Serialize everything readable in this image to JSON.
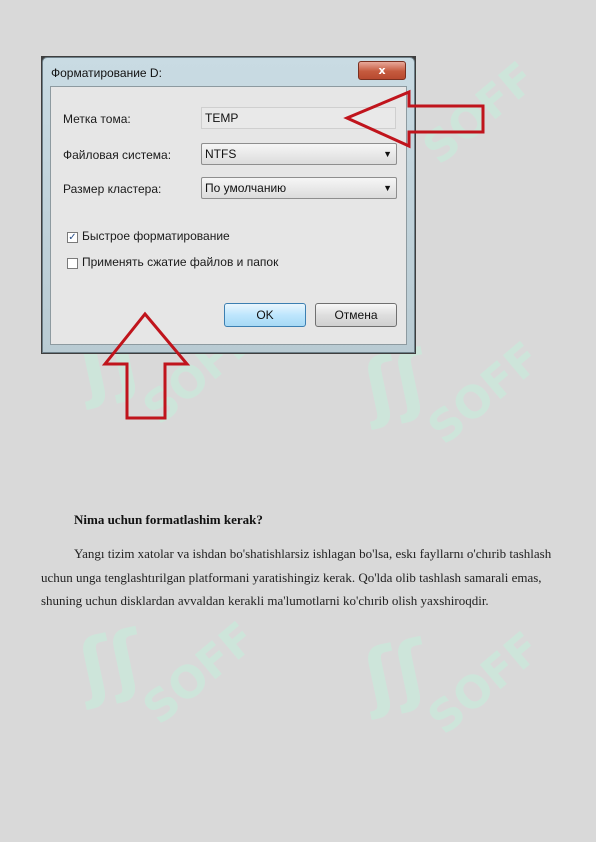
{
  "dialog": {
    "title": "Форматирование D:",
    "close_label": "x",
    "volume_label_caption": "Метка тома:",
    "volume_label_value": "TEMP",
    "filesystem_caption": "Файловая система:",
    "filesystem_value": "NTFS",
    "cluster_size_caption": "Размер кластера:",
    "cluster_size_value": "По умолчанию",
    "quick_format_label": "Быстрое форматирование",
    "quick_format_checked": true,
    "compression_label": "Применять сжатие файлов и папок",
    "compression_checked": false,
    "ok_label": "OK",
    "cancel_label": "Отмена"
  },
  "annotations": {
    "arrow_color": "#c0141c"
  },
  "article": {
    "heading": "Nima uchun formatlashim kerak?",
    "paragraph": "Yangı tizim   xatolar va ishdan bo'shatishlarsiz ishlagan bo'lsa, eskı fayllarnı o'chırib tashlash uchun unga tenglashtırilgan platformani yaratishingiz kerak. Qo'lda olib tashlash samarali emas, shuning uchun disklardan avvaldan kerakli ma'lumotlarni ko'chırib olish yaxshiroqdir."
  },
  "watermark": {
    "glyph": "ʃʃ",
    "text": "SOFF"
  }
}
